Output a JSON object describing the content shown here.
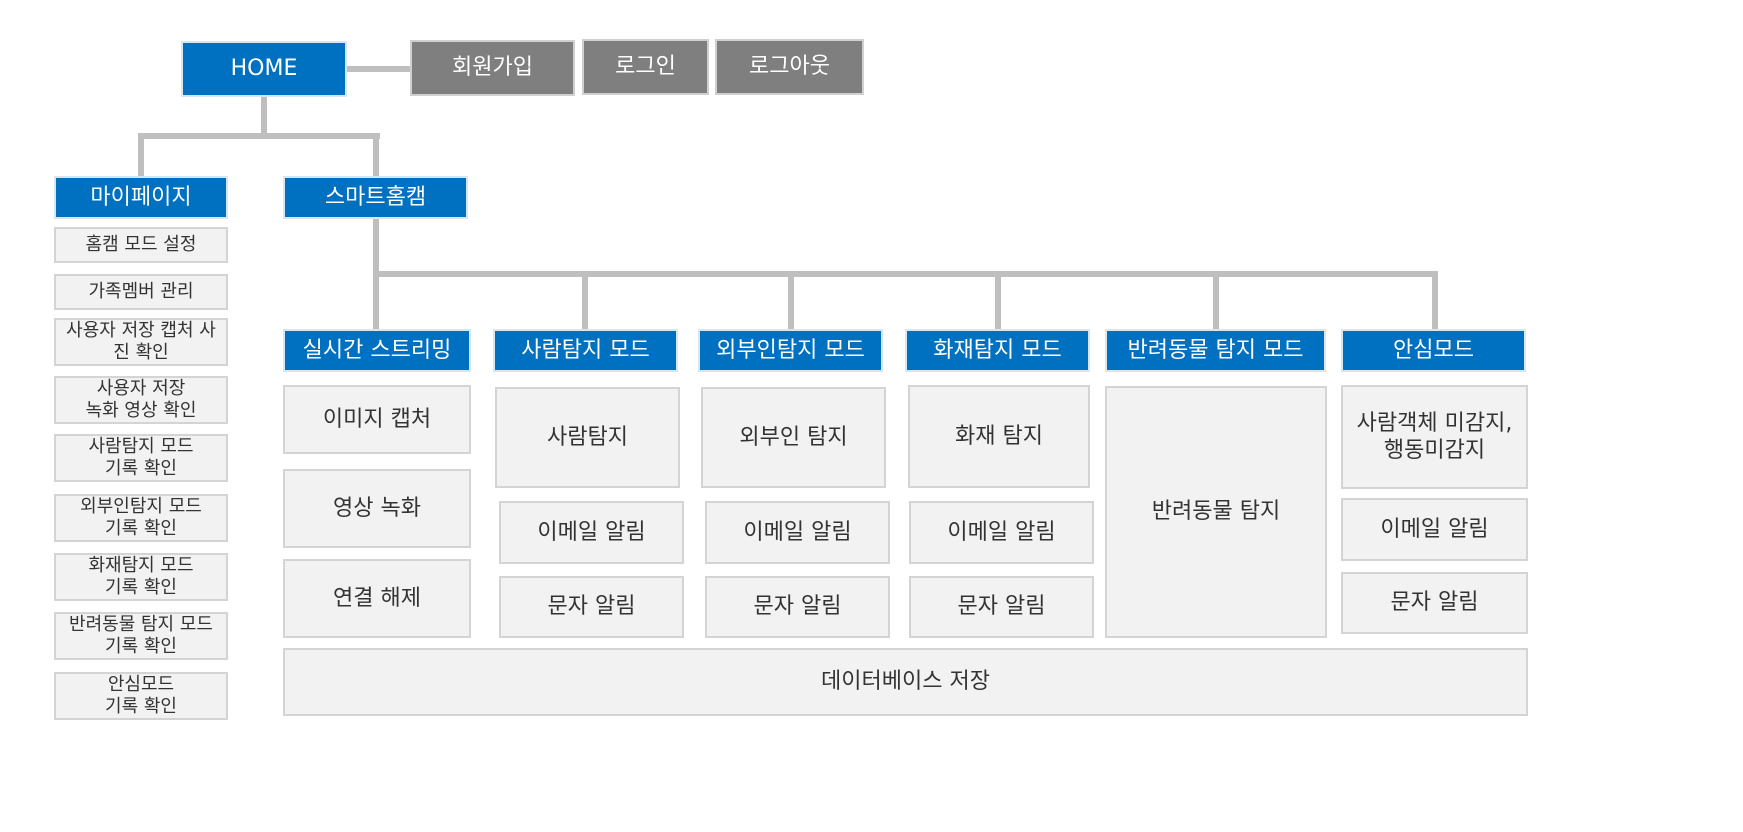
{
  "top": {
    "home": "HOME",
    "signup": "회원가입",
    "login": "로그인",
    "logout": "로그아웃"
  },
  "mypage": {
    "title": "마이페이지",
    "items": [
      "홈캠 모드 설정",
      "가족멤버 관리",
      "사용자 저장 캡처 사\n진 확인",
      "사용자 저장\n녹화 영상 확인",
      "사람탐지 모드\n기록 확인",
      "외부인탐지 모드\n기록 확인",
      "화재탐지 모드\n기록 확인",
      "반려동물 탐지 모드\n기록 확인",
      "안심모드\n기록 확인"
    ]
  },
  "smartcam": {
    "title": "스마트홈캠",
    "modes": [
      {
        "title": "실시간 스트리밍",
        "items": [
          "이미지 캡처",
          "영상 녹화",
          "연결 해제"
        ]
      },
      {
        "title": "사람탐지 모드",
        "items": [
          "사람탐지",
          "이메일 알림",
          "문자 알림"
        ]
      },
      {
        "title": "외부인탐지 모드",
        "items": [
          "외부인 탐지",
          "이메일 알림",
          "문자 알림"
        ]
      },
      {
        "title": "화재탐지 모드",
        "items": [
          "화재 탐지",
          "이메일 알림",
          "문자 알림"
        ]
      },
      {
        "title": "반려동물 탐지 모드",
        "items": [
          "반려동물 탐지"
        ]
      },
      {
        "title": "안심모드",
        "items": [
          "사람객체 미감지,\n행동미감지",
          "이메일 알림",
          "문자 알림"
        ]
      }
    ],
    "database": "데이터베이스 저장"
  },
  "colors": {
    "primary_blue": "#0070c0",
    "account_gray": "#7f7f7f",
    "leaf_fill": "#f2f2f2",
    "connector": "#bfbfbf"
  }
}
